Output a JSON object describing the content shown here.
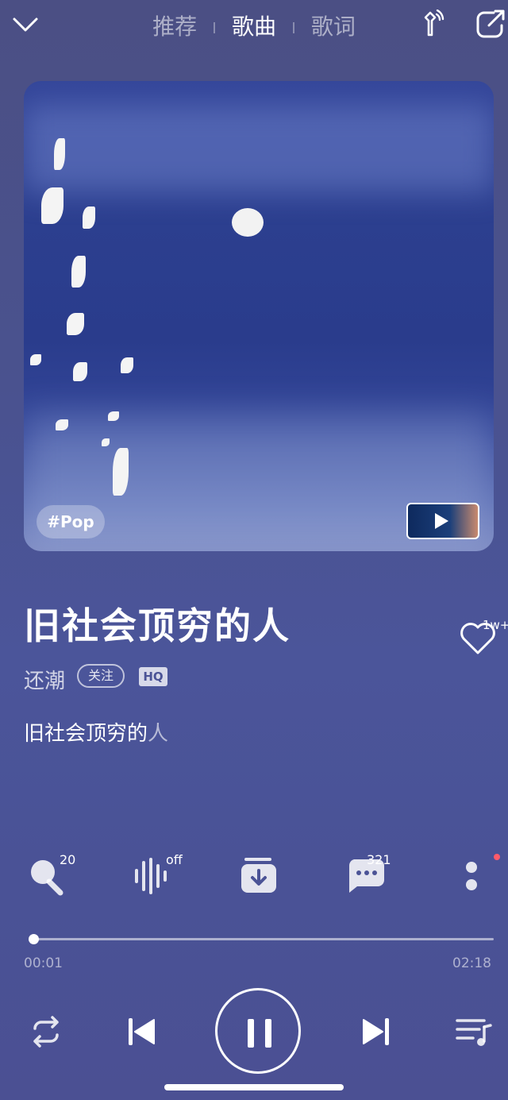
{
  "header": {
    "tabs": [
      {
        "label": "推荐",
        "active": false
      },
      {
        "label": "歌曲",
        "active": true
      },
      {
        "label": "歌词",
        "active": false
      }
    ],
    "icons": [
      "chevron-down-icon",
      "broadcast-tower-icon",
      "share-icon"
    ]
  },
  "cover": {
    "tag": "#Pop",
    "mv_preview_icon": "play-icon"
  },
  "song": {
    "title": "旧社会顶穷的人",
    "artist": "还潮",
    "follow_label": "关注",
    "quality_badge": "HQ",
    "like_count": "1w+",
    "lyric_main": "旧社会顶穷的",
    "lyric_tail": "人"
  },
  "actions": {
    "sing_count": "20",
    "sound_effect_state": "off",
    "comment_count": "321"
  },
  "progress": {
    "current_time": "00:01",
    "total_time": "02:18",
    "fraction": 0.007
  },
  "colors": {
    "background": "#4a528f",
    "accent_dot": "#ff5a6a",
    "text": "#ffffff"
  }
}
